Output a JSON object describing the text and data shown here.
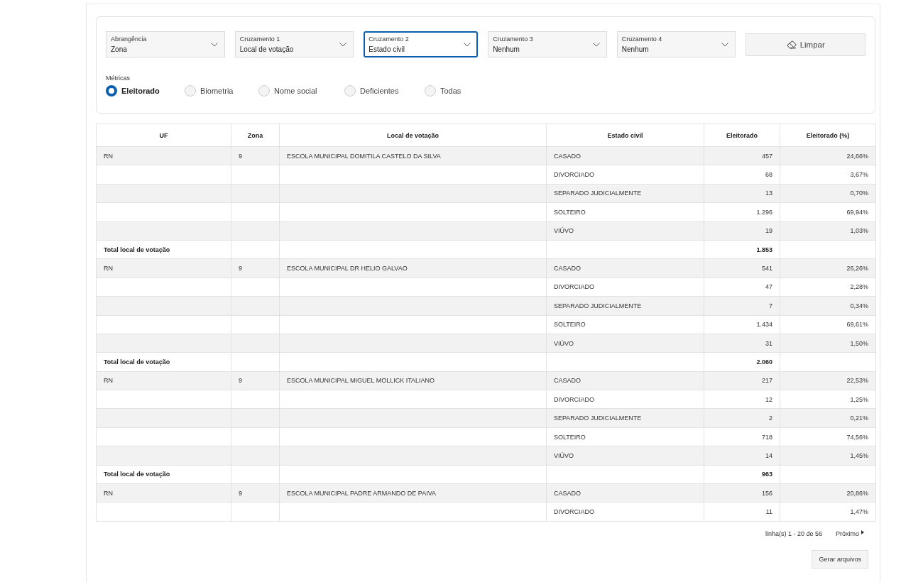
{
  "filters": [
    {
      "label": "Abrangência",
      "value": "Zona",
      "focused": false
    },
    {
      "label": "Cruzamento 1",
      "value": "Local de votação",
      "focused": false
    },
    {
      "label": "Cruzamento 2",
      "value": "Estado civil",
      "focused": true
    },
    {
      "label": "Cruzamento 3",
      "value": "Nenhum",
      "focused": false
    },
    {
      "label": "Cruzamento 4",
      "value": "Nenhum",
      "focused": false
    }
  ],
  "clear_button": "Limpar",
  "metrics": {
    "label": "Métricas",
    "options": [
      {
        "label": "Eleitorado",
        "selected": true
      },
      {
        "label": "Biometria",
        "selected": false
      },
      {
        "label": "Nome social",
        "selected": false
      },
      {
        "label": "Deficientes",
        "selected": false
      },
      {
        "label": "Todas",
        "selected": false
      }
    ]
  },
  "table": {
    "columns": [
      "UF",
      "Zona",
      "Local de votação",
      "Estado civil",
      "Eleitorado",
      "Eleitorado (%)"
    ],
    "rows": [
      {
        "kind": "data",
        "uf": "RN",
        "zona": "9",
        "local": "ESCOLA MUNICIPAL DOMITILA CASTELO DA SILVA",
        "estado": "CASADO",
        "eleitorado": "457",
        "pct": "24,66%"
      },
      {
        "kind": "data",
        "estado": "DIVORCIADO",
        "eleitorado": "68",
        "pct": "3,67%"
      },
      {
        "kind": "data",
        "estado": "SEPARADO JUDICIALMENTE",
        "eleitorado": "13",
        "pct": "0,70%"
      },
      {
        "kind": "data",
        "estado": "SOLTEIRO",
        "eleitorado": "1.296",
        "pct": "69,94%"
      },
      {
        "kind": "data",
        "estado": "VIÚVO",
        "eleitorado": "19",
        "pct": "1,03%"
      },
      {
        "kind": "total",
        "uf": "Total local de votação",
        "eleitorado": "1.853"
      },
      {
        "kind": "data",
        "uf": "RN",
        "zona": "9",
        "local": "ESCOLA MUNICIPAL DR HELIO GALVAO",
        "estado": "CASADO",
        "eleitorado": "541",
        "pct": "26,26%"
      },
      {
        "kind": "data",
        "estado": "DIVORCIADO",
        "eleitorado": "47",
        "pct": "2,28%"
      },
      {
        "kind": "data",
        "estado": "SEPARADO JUDICIALMENTE",
        "eleitorado": "7",
        "pct": "0,34%"
      },
      {
        "kind": "data",
        "estado": "SOLTEIRO",
        "eleitorado": "1.434",
        "pct": "69,61%"
      },
      {
        "kind": "data",
        "estado": "VIÚVO",
        "eleitorado": "31",
        "pct": "1,50%"
      },
      {
        "kind": "total",
        "uf": "Total local de votação",
        "eleitorado": "2.060"
      },
      {
        "kind": "data",
        "uf": "RN",
        "zona": "9",
        "local": "ESCOLA MUNICIPAL MIGUEL MOLLICK ITALIANO",
        "estado": "CASADO",
        "eleitorado": "217",
        "pct": "22,53%"
      },
      {
        "kind": "data",
        "estado": "DIVORCIADO",
        "eleitorado": "12",
        "pct": "1,25%"
      },
      {
        "kind": "data",
        "estado": "SEPARADO JUDICIALMENTE",
        "eleitorado": "2",
        "pct": "0,21%"
      },
      {
        "kind": "data",
        "estado": "SOLTEIRO",
        "eleitorado": "718",
        "pct": "74,56%"
      },
      {
        "kind": "data",
        "estado": "VIÚVO",
        "eleitorado": "14",
        "pct": "1,45%"
      },
      {
        "kind": "total",
        "uf": "Total local de votação",
        "eleitorado": "963"
      },
      {
        "kind": "data",
        "uf": "RN",
        "zona": "9",
        "local": "ESCOLA MUNICIPAL PADRE ARMANDO DE PAIVA",
        "estado": "CASADO",
        "eleitorado": "156",
        "pct": "20,86%"
      },
      {
        "kind": "data",
        "estado": "DIVORCIADO",
        "eleitorado": "11",
        "pct": "1,47%"
      }
    ]
  },
  "pagination": {
    "range": "linha(s) 1 - 20 de 56",
    "next": "Próximo"
  },
  "generate_button": "Gerar arquivos"
}
